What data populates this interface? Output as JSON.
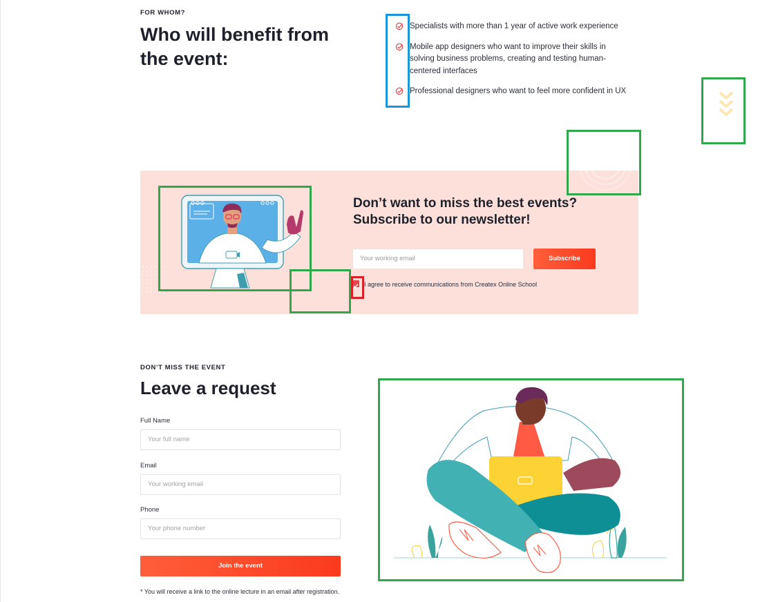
{
  "benefit_section": {
    "eyebrow": "FOR WHOM?",
    "title_line1": "Who will benefit from",
    "title_line2": "the event:",
    "items": [
      {
        "text": "Specialists with more than 1 year of active work experience",
        "icon": "check-circle-icon"
      },
      {
        "text": "Mobile app designers who want to improve their skills in solving business problems, creating and testing human-centered interfaces",
        "icon": "check-circle-icon"
      },
      {
        "text": "Professional designers who want to feel more confident in UX",
        "icon": "check-circle-icon"
      }
    ]
  },
  "newsletter": {
    "title_line1": "Don’t want to miss the best events?",
    "title_line2": "Subscribe to our newsletter!",
    "email_placeholder": "Your working email",
    "subscribe_label": "Subscribe",
    "agree_text": "I agree to receive communications from Createx Online School",
    "agree_checked": true
  },
  "request_section": {
    "eyebrow": "DON’T MISS THE EVENT",
    "title": "Leave a request",
    "full_name_label": "Full Name",
    "full_name_placeholder": "Your full name",
    "email_label": "Email",
    "email_placeholder": "Your working email",
    "phone_label": "Phone",
    "phone_placeholder": "Your phone number",
    "join_label": "Join the event",
    "note": "* You will receive a link to the online lecture in an email after registration."
  },
  "colors": {
    "accent": "#ff5a36",
    "newsletter_bg": "#fde0d9",
    "check_red": "#e8464f",
    "annotation_green": "#2ea84a",
    "annotation_blue": "#1a95d8",
    "annotation_red": "#d9232b"
  }
}
